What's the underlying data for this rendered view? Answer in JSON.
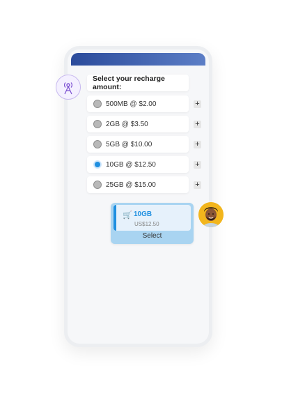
{
  "chat": {
    "prompt": "Select your recharge amount:",
    "options": [
      {
        "label": "500MB @ $2.00",
        "selected": false
      },
      {
        "label": "2GB @ $3.50",
        "selected": false
      },
      {
        "label": "5GB @ $10.00",
        "selected": false
      },
      {
        "label": "10GB @ $12.50",
        "selected": true
      },
      {
        "label": "25GB @ $15.00",
        "selected": false
      }
    ],
    "plus_label": "+",
    "selection": {
      "plan": "10GB",
      "price": "US$12.50",
      "action": "Select"
    }
  },
  "icons": {
    "bot": "antenna-icon",
    "cart": "cart-icon",
    "user": "user-avatar"
  },
  "colors": {
    "accent": "#1f8fe0",
    "header": "#2b4b9b"
  }
}
